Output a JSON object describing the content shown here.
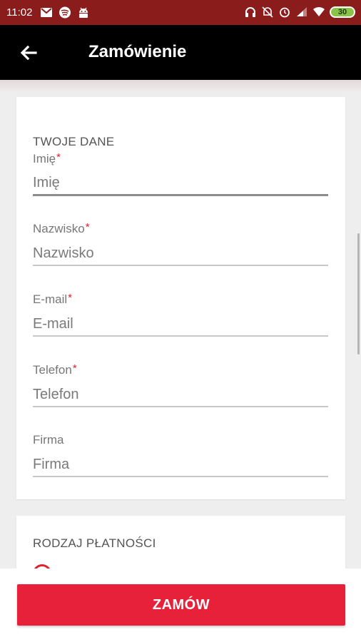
{
  "status_bar": {
    "time": "11:02",
    "battery": "30",
    "left_icons": [
      "gmail-icon",
      "spotify-icon",
      "android-icon"
    ],
    "right_icons": [
      "headphones-icon",
      "bell-off-icon",
      "alarm-icon",
      "signal-icon",
      "wifi-icon"
    ],
    "colors": {
      "background": "#8b1c1c",
      "battery_fill": "#8bc34a"
    }
  },
  "app_bar": {
    "title": "Zamówienie",
    "back_icon": "arrow-left-icon"
  },
  "personal_data": {
    "title": "TWOJE DANE",
    "fields": [
      {
        "label": "Imię",
        "required": "*",
        "placeholder": "Imię",
        "value": ""
      },
      {
        "label": "Nazwisko",
        "required": "*",
        "placeholder": "Nazwisko",
        "value": ""
      },
      {
        "label": "E-mail",
        "required": "*",
        "placeholder": "E-mail",
        "value": ""
      },
      {
        "label": "Telefon",
        "required": "*",
        "placeholder": "Telefon",
        "value": ""
      },
      {
        "label": "Firma",
        "required": "",
        "placeholder": "Firma",
        "value": ""
      }
    ]
  },
  "payment": {
    "title": "RODZAJ PŁATNOŚCI"
  },
  "order_button": {
    "label": "ZAMÓW"
  },
  "colors": {
    "accent": "#e8213a",
    "app_bar": "#000000",
    "background": "#efeeee"
  }
}
